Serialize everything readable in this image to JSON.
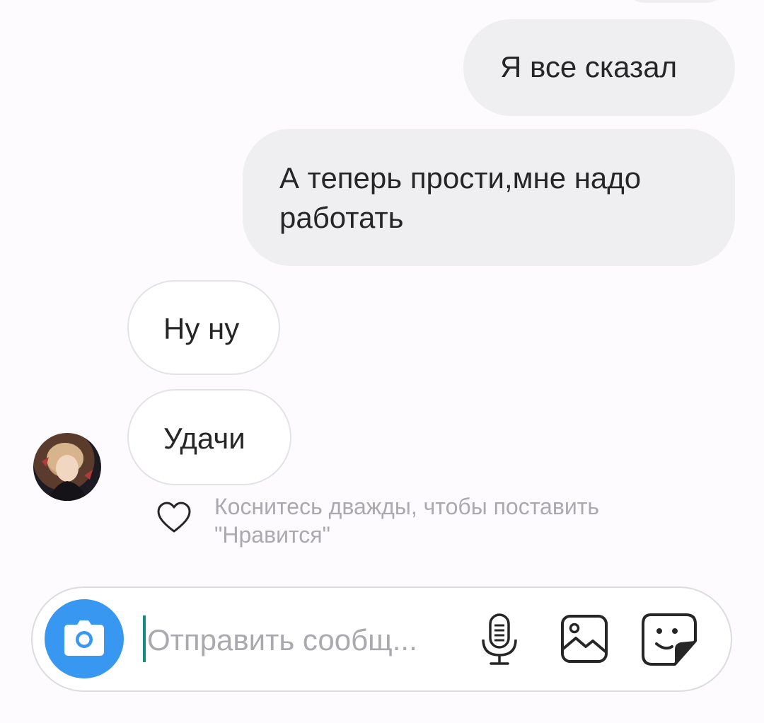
{
  "thread": {
    "messages": [
      {
        "direction": "outgoing",
        "text": "Я все сказал"
      },
      {
        "direction": "outgoing",
        "text": "А теперь прости,мне надо работать"
      },
      {
        "direction": "incoming",
        "text": "Ну ну"
      },
      {
        "direction": "incoming",
        "text": "Удачи"
      }
    ],
    "like_hint": "Коснитесь дважды, чтобы поставить \"Нравится\""
  },
  "composer": {
    "placeholder": "Отправить сообщ..."
  },
  "icons": {
    "camera": "camera-icon",
    "heart": "heart-icon",
    "mic": "microphone-icon",
    "gallery": "gallery-icon",
    "sticker": "sticker-icon"
  },
  "colors": {
    "accent": "#3897f0",
    "outgoing_bubble": "#efeff1",
    "caret": "#128c7e"
  }
}
